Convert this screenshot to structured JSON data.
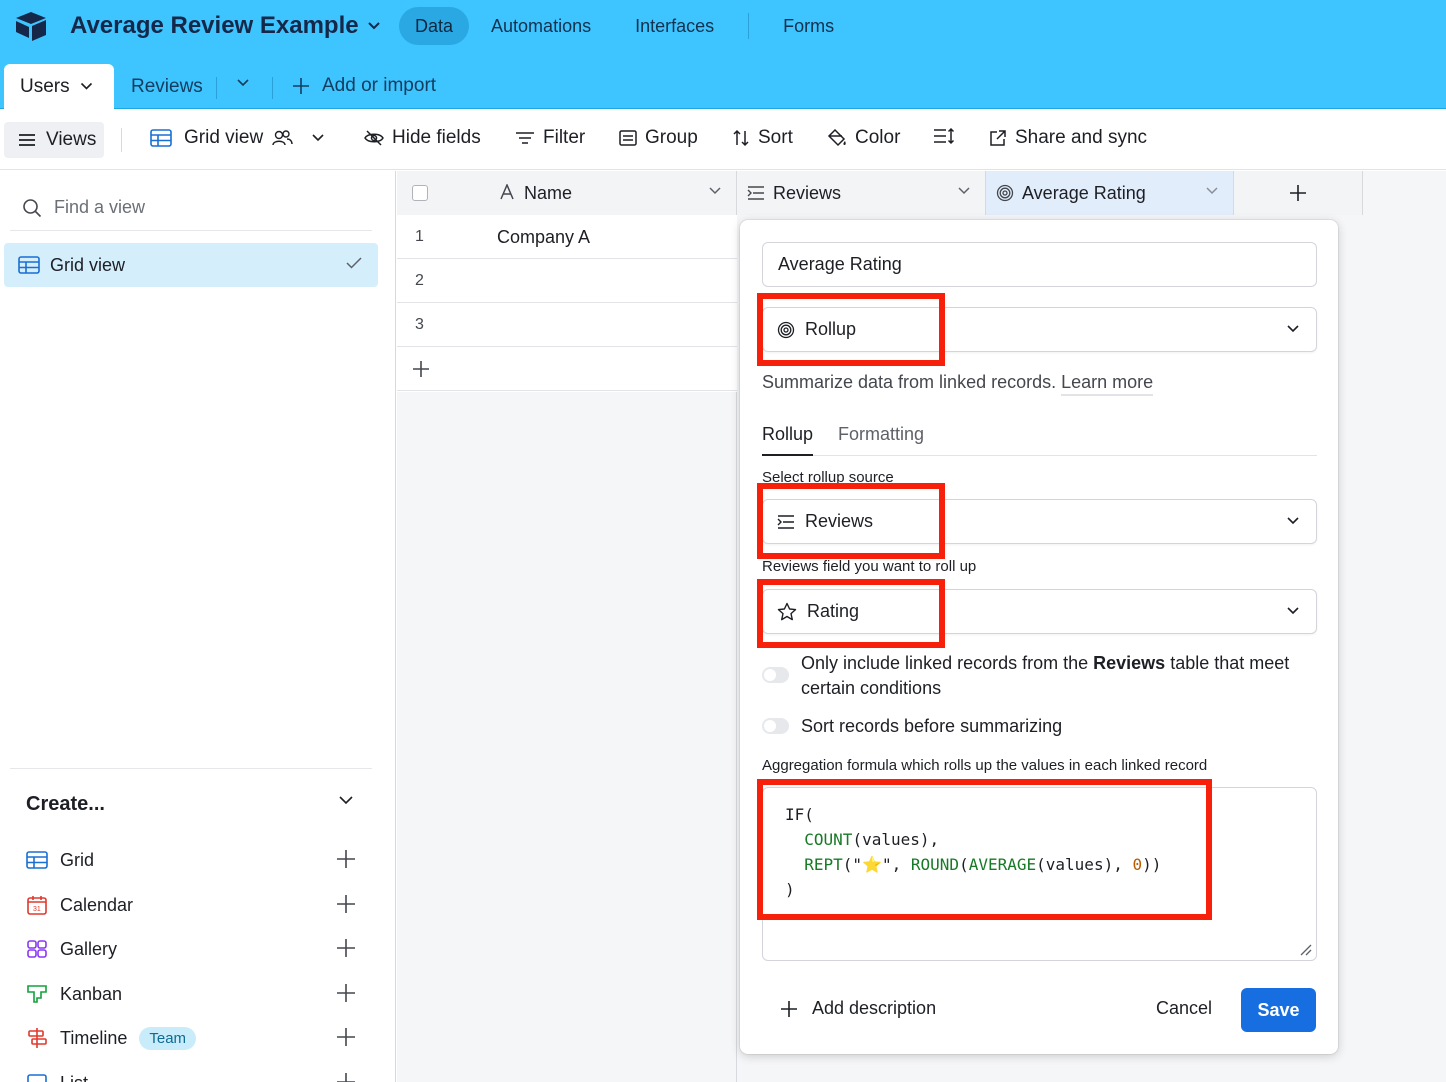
{
  "header": {
    "base_name": "Average Review Example",
    "nav": [
      "Data",
      "Automations",
      "Interfaces",
      "Forms"
    ],
    "active_nav": "Data"
  },
  "tabs": {
    "active": "Users",
    "other": "Reviews",
    "add_label": "Add or import"
  },
  "toolbar": {
    "views": "Views",
    "grid_view": "Grid view",
    "hide_fields": "Hide fields",
    "filter": "Filter",
    "group": "Group",
    "sort": "Sort",
    "color": "Color",
    "share": "Share and sync"
  },
  "sidebar": {
    "find_placeholder": "Find a view",
    "current_view": "Grid view",
    "create_title": "Create...",
    "create_items": [
      {
        "label": "Grid",
        "icon": "grid-icon"
      },
      {
        "label": "Calendar",
        "icon": "calendar-icon"
      },
      {
        "label": "Gallery",
        "icon": "gallery-icon"
      },
      {
        "label": "Kanban",
        "icon": "kanban-icon"
      },
      {
        "label": "Timeline",
        "icon": "timeline-icon",
        "badge": "Team"
      },
      {
        "label": "List",
        "icon": "list-icon"
      }
    ]
  },
  "grid": {
    "columns": [
      "Name",
      "Reviews",
      "Average Rating"
    ],
    "rows": [
      {
        "num": "1",
        "name": "Company A"
      },
      {
        "num": "2",
        "name": ""
      },
      {
        "num": "3",
        "name": ""
      }
    ]
  },
  "popup": {
    "field_name": "Average Rating",
    "field_type": "Rollup",
    "help_text": "Summarize data from linked records.",
    "learn_more": "Learn more",
    "tabs": [
      "Rollup",
      "Formatting"
    ],
    "source_label": "Select rollup source",
    "source_value": "Reviews",
    "field_label": "Reviews field you want to roll up",
    "field_value": "Rating",
    "toggle1_pre": "Only include linked records from the ",
    "toggle1_bold": "Reviews",
    "toggle1_post": " table that meet certain conditions",
    "toggle2": "Sort records before summarizing",
    "formula_label": "Aggregation formula which rolls up the values in each linked record",
    "formula": {
      "l1": "IF(",
      "l2_fn": "COUNT",
      "l2_rest": "(values),",
      "l3_fn1": "REPT",
      "l3_str": "(\"⭐\", ",
      "l3_fn2": "ROUND",
      "l3_p": "(",
      "l3_fn3": "AVERAGE",
      "l3_mid": "(values), ",
      "l3_num": "0",
      "l3_end": "))",
      "l4": ")"
    },
    "add_description": "Add description",
    "cancel": "Cancel",
    "save": "Save"
  },
  "colors": {
    "header_bg": "#3ec5ff",
    "save_blue": "#166ee1",
    "highlight_red": "#f7210b"
  }
}
